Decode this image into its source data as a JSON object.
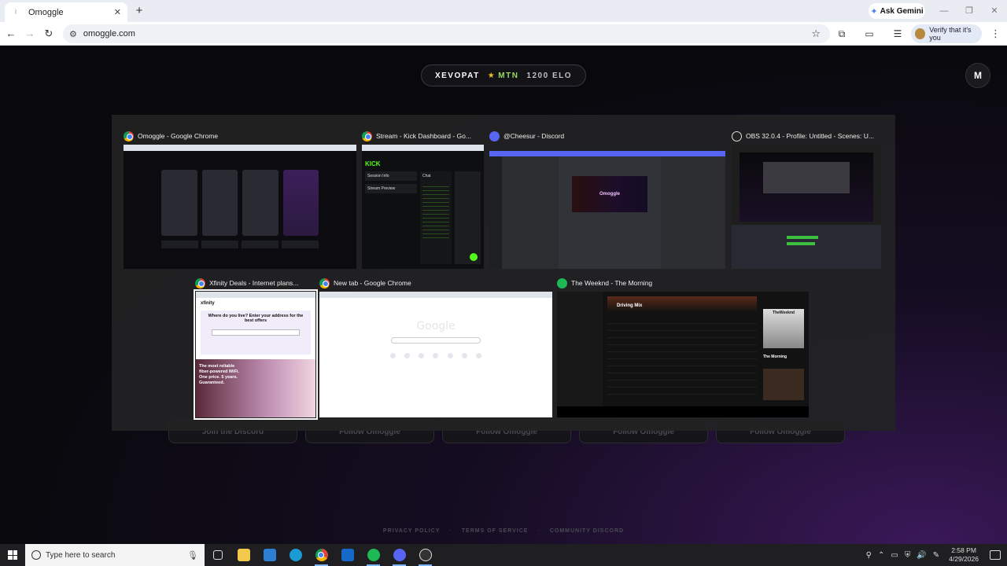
{
  "browser": {
    "tab_title": "Omoggle",
    "gemini_label": "Ask Gemini",
    "url": "omoggle.com",
    "verify_label": "Verify that it's you"
  },
  "page": {
    "username": "XEVOPAT",
    "rank": "MTN",
    "elo": "1200 ELO",
    "menu_initial": "M",
    "background_buttons": [
      "Join the Discord",
      "Follow Omoggle",
      "Follow Omoggle",
      "Follow Omoggle",
      "Follow Omoggle"
    ],
    "footer_links": [
      "PRIVACY POLICY",
      "TERMS OF SERVICE",
      "COMMUNITY DISCORD"
    ]
  },
  "switcher": {
    "windows": [
      {
        "title": "Omoggle - Google Chrome",
        "icon": "chrome-icon"
      },
      {
        "title": "Stream - Kick Dashboard - Go...",
        "icon": "chrome-icon"
      },
      {
        "title": "@Cheesur - Discord",
        "icon": "discord-icon"
      },
      {
        "title": "OBS 32.0.4 - Profile: Untitled - Scenes: U...",
        "icon": "obs-icon"
      },
      {
        "title": "Xfinity Deals - Internet plans...",
        "icon": "chrome-icon",
        "selected": true
      },
      {
        "title": "New tab - Google Chrome",
        "icon": "chrome-icon"
      },
      {
        "title": "The Weeknd - The Morning",
        "icon": "spotify-icon"
      }
    ],
    "thumb_text": {
      "kick_logo": "KICK",
      "kick_session": "Session Info",
      "kick_preview": "Stream Preview",
      "kick_chat": "Chat",
      "discord_banner": "Omoggle",
      "xfinity_logo": "xfinity",
      "xfinity_question": "Where do you live? Enter your address for the best offers",
      "xfinity_promo": "The most reliable fiber-powered WiFi. One price. 5 years. Guaranteed.",
      "google_logo": "Google",
      "spotify_playlist": "Driving Mix",
      "spotify_artist": "TheWeeknd",
      "spotify_track": "The Morning"
    }
  },
  "taskbar": {
    "search_placeholder": "Type here to search",
    "time": "2:58 PM",
    "date": "4/29/2026"
  },
  "colors": {
    "accent_purple": "#8a4fd8",
    "kick_green": "#53fc18",
    "spotify_green": "#1db954",
    "discord_blurple": "#5865f2"
  }
}
